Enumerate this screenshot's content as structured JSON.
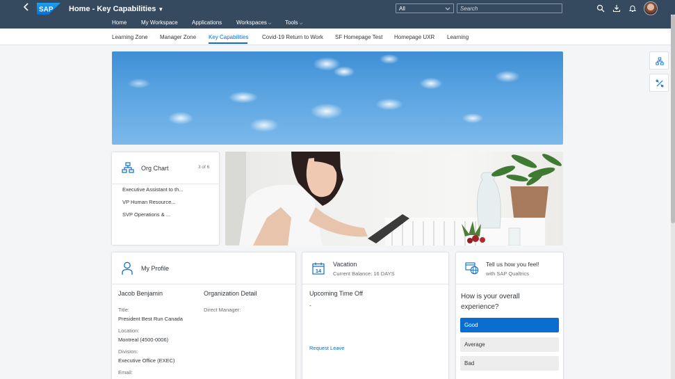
{
  "shell": {
    "title": "Home - Key Capabilities",
    "nav": [
      "Home",
      "My Workspace",
      "Applications",
      "Workspaces",
      "Tools"
    ],
    "search_scope": "All",
    "search_placeholder": "Search",
    "logo_text": "SAP"
  },
  "tabs": [
    "Learning Zone",
    "Manager Zone",
    "Key Capabilities",
    "Covid-19 Return to Work",
    "SF Homepage Test",
    "Homepage UXR",
    "Learning"
  ],
  "active_tab": "Key Capabilities",
  "org_chart": {
    "title": "Org Chart",
    "pager": "3 of 6",
    "items": [
      "Executive Assistant to th...",
      "VP Human Resource...",
      "SVP Operations & ..."
    ]
  },
  "profile": {
    "title": "My Profile",
    "name": "Jacob Benjamin",
    "org_heading": "Organization Detail",
    "title_label": "Title:",
    "title_value": "President Best Run Canada",
    "location_label": "Location:",
    "location_value": "Montreal (4500-0006)",
    "division_label": "Division:",
    "division_value": "Executive Office (EXEC)",
    "email_label": "Email:",
    "manager_label": "Direct Manager:"
  },
  "vacation": {
    "title": "Vacation",
    "balance": "Current Balance: 16 DAYS",
    "calendar_day": "14",
    "upcoming_heading": "Upcoming Time Off",
    "upcoming_value": "-",
    "request_link": "Request Leave"
  },
  "survey": {
    "title": "Tell us how you feel!",
    "subtitle": "with SAP Qualtrics",
    "question_line1": "How is your overall",
    "question_line2": "experience?",
    "options": [
      "Good",
      "Average",
      "Bad"
    ],
    "selected": "Good"
  },
  "colors": {
    "shell_bg": "#354a5f",
    "accent": "#0a6ed1",
    "sap_blue": "#0a6ed1"
  }
}
